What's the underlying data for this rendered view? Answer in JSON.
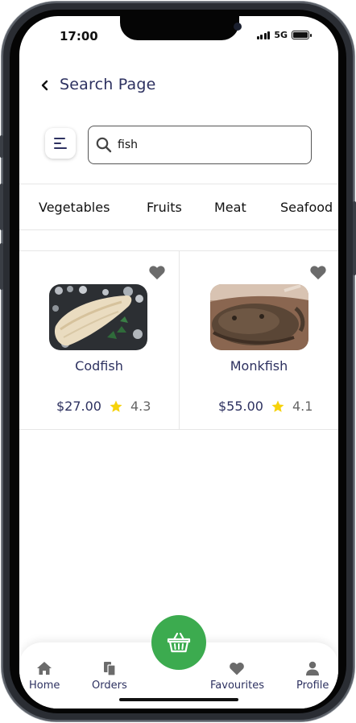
{
  "status_bar": {
    "time": "17:00",
    "network": "5G"
  },
  "header": {
    "title": "Search Page"
  },
  "search": {
    "value": "fish",
    "placeholder": ""
  },
  "categories": [
    "Vegetables",
    "Fruits",
    "Meat",
    "Seafood"
  ],
  "products": [
    {
      "name": "Codfish",
      "price": "$27.00",
      "rating": "4.3"
    },
    {
      "name": "Monkfish",
      "price": "$55.00",
      "rating": "4.1"
    }
  ],
  "nav": {
    "home": "Home",
    "orders": "Orders",
    "favourites": "Favourites",
    "profile": "Profile"
  },
  "colors": {
    "accent_green": "#3cab4f",
    "text_navy": "#2d3160",
    "star_yellow": "#f6d20b",
    "heart_grey": "#6b6b6b"
  },
  "icons": [
    "back-icon",
    "menu-icon",
    "search-icon",
    "heart-icon",
    "star-icon",
    "home-icon",
    "orders-icon",
    "basket-icon",
    "favourites-icon",
    "profile-icon"
  ]
}
